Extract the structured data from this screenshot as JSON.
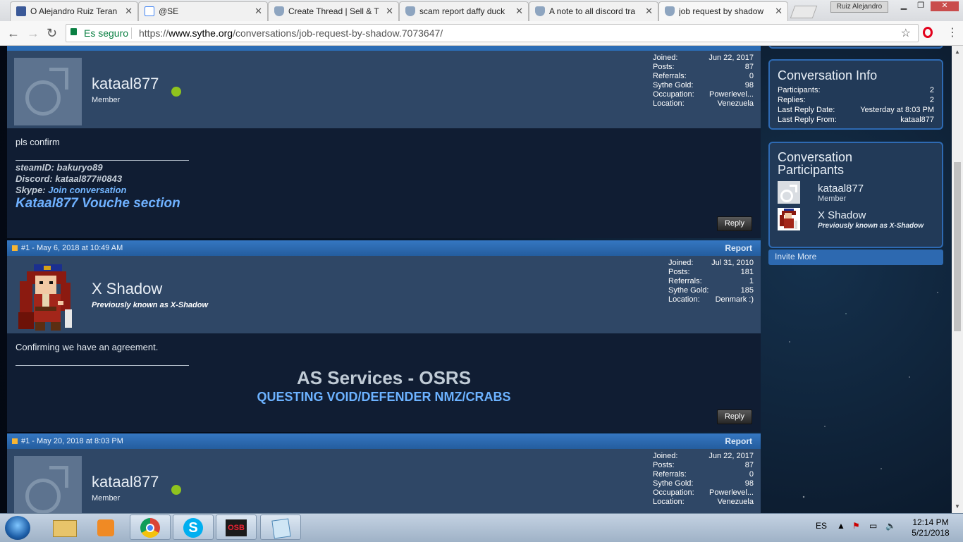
{
  "browser": {
    "tabs": [
      {
        "title": "O Alejandro Ruiz Teran",
        "favicon": "facebook-icon"
      },
      {
        "title": "@SE",
        "favicon": "google-calendar-icon"
      },
      {
        "title": "Create Thread | Sell & T",
        "favicon": "sythe-shield-icon"
      },
      {
        "title": "scam report daffy duck",
        "favicon": "sythe-shield-icon"
      },
      {
        "title": "A note to all discord tra",
        "favicon": "sythe-shield-icon"
      },
      {
        "title": "job request by shadow",
        "favicon": "sythe-shield-icon"
      }
    ],
    "window_user": "Ruiz Alejandro",
    "secure_label": "Es seguro",
    "url_scheme": "https://",
    "url_host": "www.sythe.org",
    "url_path": "/conversations/job-request-by-shadow.7073647/"
  },
  "posts": [
    {
      "username": "kataal877",
      "role": "Member",
      "online": true,
      "stats": [
        {
          "label": "Joined:",
          "value": "Jun 22, 2017"
        },
        {
          "label": "Posts:",
          "value": "87"
        },
        {
          "label": "Referrals:",
          "value": "0"
        },
        {
          "label": "Sythe Gold:",
          "value": "98"
        },
        {
          "label": "Occupation:",
          "value": "Powerlevel..."
        },
        {
          "label": "Location:",
          "value": "Venezuela"
        }
      ],
      "message": "pls confirm",
      "sig_steam": "steamID: bakuryo89",
      "sig_discord": "Discord: kataal877#0843",
      "sig_skype_label": "Skype: ",
      "sig_skype_link": "Join conversation",
      "sig_vouch": "Kataal877 Vouche section",
      "reply_label": "Reply"
    },
    {
      "number": "#1 - May 6, 2018 at 10:49 AM",
      "report_label": "Report",
      "username": "X Shadow",
      "role": "Previously known as X-Shadow",
      "stats": [
        {
          "label": "Joined:",
          "value": "Jul 31, 2010"
        },
        {
          "label": "Posts:",
          "value": "181"
        },
        {
          "label": "Referrals:",
          "value": "1"
        },
        {
          "label": "Sythe Gold:",
          "value": "185"
        },
        {
          "label": "Location:",
          "value": "Denmark :)"
        }
      ],
      "message": "Confirming we have an agreement.",
      "sig_title": "AS Services - OSRS",
      "sig_sub": "QUESTING VOID/DEFENDER NMZ/CRABS",
      "reply_label": "Reply"
    },
    {
      "number": "#1 - May 20, 2018 at 8:03 PM",
      "report_label": "Report",
      "username": "kataal877",
      "role": "Member",
      "online": true,
      "stats": [
        {
          "label": "Joined:",
          "value": "Jun 22, 2017"
        },
        {
          "label": "Posts:",
          "value": "87"
        },
        {
          "label": "Referrals:",
          "value": "0"
        },
        {
          "label": "Sythe Gold:",
          "value": "98"
        },
        {
          "label": "Occupation:",
          "value": "Powerlevel..."
        },
        {
          "label": "Location:",
          "value": "Venezuela"
        }
      ]
    }
  ],
  "sidebar": {
    "info_title": "Conversation Info",
    "info_rows": [
      {
        "label": "Participants:",
        "value": "2"
      },
      {
        "label": "Replies:",
        "value": "2"
      },
      {
        "label": "Last Reply Date:",
        "value": "Yesterday at 8:03 PM"
      },
      {
        "label": "Last Reply From:",
        "value": "kataal877"
      }
    ],
    "participants_title": "Conversation Participants",
    "participants": [
      {
        "name": "kataal877",
        "role": "Member"
      },
      {
        "name": "X Shadow",
        "role": "Previously known as X-Shadow"
      }
    ],
    "invite_label": "Invite More"
  },
  "taskbar": {
    "apps": [
      "file-explorer-icon",
      "media-player-icon",
      "chrome-icon",
      "skype-icon",
      "osb-icon",
      "notepad-icon"
    ],
    "osb_label": "OSB",
    "language": "ES",
    "time": "12:14 PM",
    "date": "5/21/2018"
  },
  "colors": {
    "accent": "#2c6db5",
    "online": "#8fc31e",
    "link": "#6fb1ff"
  }
}
